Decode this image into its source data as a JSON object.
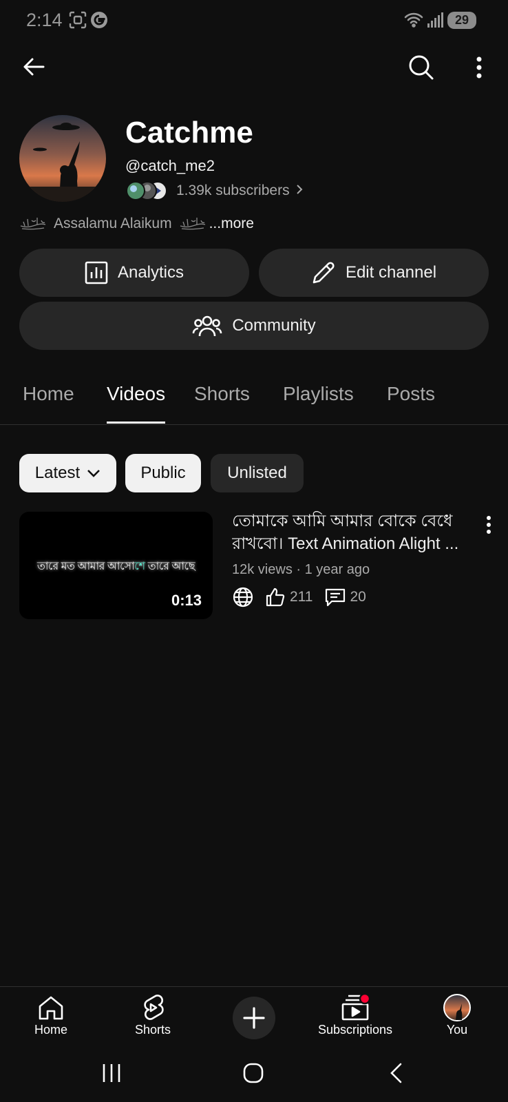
{
  "status_bar": {
    "time": "2:14",
    "battery": "29"
  },
  "channel": {
    "name": "Catchme",
    "handle": "@catch_me2",
    "subscribers": "1.39k subscribers",
    "description": "Assalamu Alaikum",
    "more_label": "...more"
  },
  "actions": {
    "analytics": "Analytics",
    "edit_channel": "Edit channel",
    "community": "Community"
  },
  "tabs": [
    {
      "label": "Home",
      "active": false
    },
    {
      "label": "Videos",
      "active": true
    },
    {
      "label": "Shorts",
      "active": false
    },
    {
      "label": "Playlists",
      "active": false
    },
    {
      "label": "Posts",
      "active": false
    }
  ],
  "filters": {
    "sort": "Latest",
    "public": "Public",
    "unlisted": "Unlisted"
  },
  "videos": [
    {
      "title_line1": "তোমাকে আমি আমার বোকে বেধে",
      "title_line2": "রাখবো। Text Animation Alight ...",
      "thumbnail_text_a": "তারে মত আমার আসো",
      "thumbnail_text_b": "শে",
      "thumbnail_text_c": " তারে আছে",
      "duration": "0:13",
      "views": "12k views",
      "age": "1 year ago",
      "likes": "211",
      "comments": "20"
    }
  ],
  "bottom_nav": {
    "home": "Home",
    "shorts": "Shorts",
    "subscriptions": "Subscriptions",
    "you": "You"
  },
  "colors": {
    "background": "#0f0f0f",
    "surface": "#272727",
    "notification": "#ff0033",
    "accent_teal": "#59e3c9"
  }
}
